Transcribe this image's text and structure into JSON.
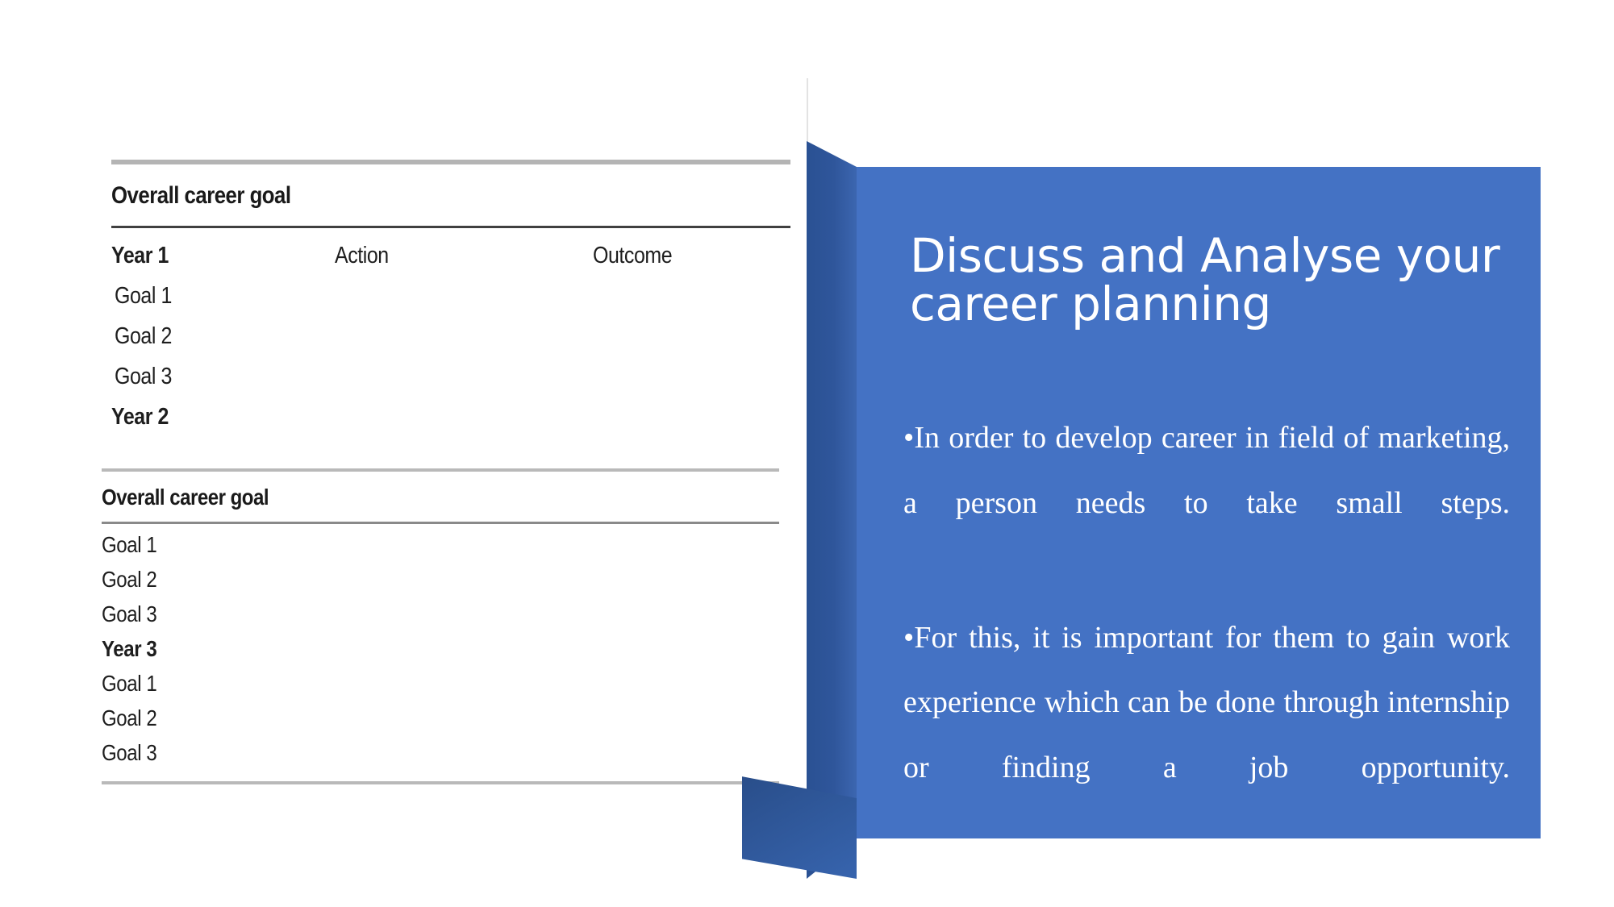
{
  "slide": {
    "background_color": "#ffffff"
  },
  "career_table": {
    "block1": {
      "heading": "Overall career goal",
      "columns": [
        "Year 1",
        "Action",
        "Outcome"
      ],
      "rows": [
        {
          "label": "Year 1",
          "bold": true,
          "action": "Action",
          "outcome": "Outcome"
        },
        {
          "label": "Goal 1",
          "bold": false,
          "action": "",
          "outcome": ""
        },
        {
          "label": "Goal 2",
          "bold": false,
          "action": "",
          "outcome": ""
        },
        {
          "label": "Goal 3",
          "bold": false,
          "action": "",
          "outcome": ""
        },
        {
          "label": "Year 2",
          "bold": true,
          "action": "",
          "outcome": ""
        }
      ]
    },
    "block2": {
      "heading": "Overall career goal",
      "rows": [
        {
          "label": "Goal 1",
          "bold": false
        },
        {
          "label": "Goal 2",
          "bold": false
        },
        {
          "label": "Goal 3",
          "bold": false
        },
        {
          "label": "Year 3",
          "bold": true
        },
        {
          "label": "Goal 1",
          "bold": false
        },
        {
          "label": "Goal 2",
          "bold": false
        },
        {
          "label": "Goal 3",
          "bold": false
        }
      ]
    },
    "rule_colors": {
      "thick_gray": "#b4b4b4",
      "thin_dark": "#404040",
      "mid_gray": "#8a8a8a"
    }
  },
  "blue_panel": {
    "title": "Discuss and Analyse your career planning",
    "bullet_marker": "•",
    "bullets": [
      "In order to develop career in field of marketing, a person needs to take small steps.",
      "For this, it is important for them to gain work experience which can be done through internship or finding a job opportunity."
    ],
    "colors": {
      "face": "#4472c4",
      "spine_dark": "#2d5499",
      "spine_darker": "#27497f",
      "text": "#ffffff"
    }
  }
}
